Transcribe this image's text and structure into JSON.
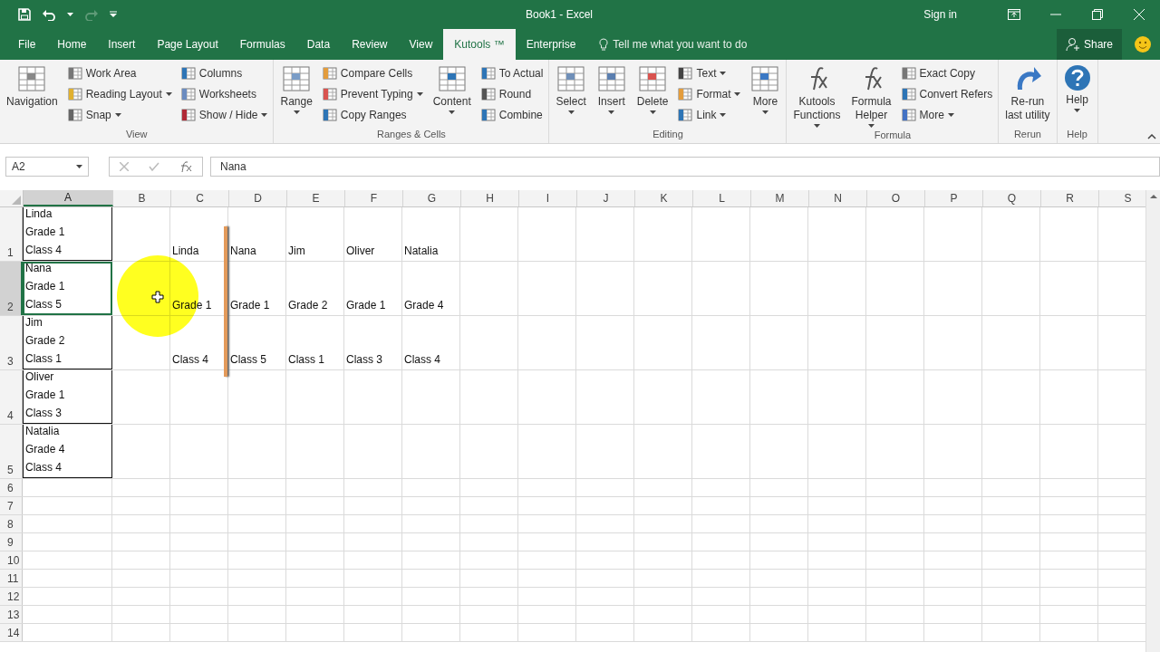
{
  "window": {
    "title": "Book1  -  Excel",
    "sign_in": "Sign in"
  },
  "tabs": [
    {
      "label": "File",
      "selected": false
    },
    {
      "label": "Home",
      "selected": false
    },
    {
      "label": "Insert",
      "selected": false
    },
    {
      "label": "Page Layout",
      "selected": false
    },
    {
      "label": "Formulas",
      "selected": false
    },
    {
      "label": "Data",
      "selected": false
    },
    {
      "label": "Review",
      "selected": false
    },
    {
      "label": "View",
      "selected": false
    },
    {
      "label": "Kutools ™",
      "selected": true
    },
    {
      "label": "Enterprise",
      "selected": false
    }
  ],
  "tell_me": "Tell me what you want to do",
  "share": "Share",
  "ribbon": {
    "groups": [
      {
        "name": "View",
        "items": [
          {
            "kind": "large",
            "label": "Navigation",
            "dropdown": false
          },
          {
            "kind": "stack",
            "items": [
              {
                "label": "Work Area",
                "dropdown": false
              },
              {
                "label": "Reading Layout",
                "dropdown": true
              },
              {
                "label": "Snap",
                "dropdown": true
              }
            ]
          },
          {
            "kind": "stack",
            "items": [
              {
                "label": "Columns",
                "dropdown": false
              },
              {
                "label": "Worksheets",
                "dropdown": false
              },
              {
                "label": "Show / Hide",
                "dropdown": true
              }
            ]
          }
        ]
      },
      {
        "name": "Ranges & Cells",
        "items": [
          {
            "kind": "large",
            "label": "Range",
            "dropdown": true
          },
          {
            "kind": "stack",
            "items": [
              {
                "label": "Compare Cells",
                "dropdown": false
              },
              {
                "label": "Prevent Typing",
                "dropdown": true
              },
              {
                "label": "Copy Ranges",
                "dropdown": false
              }
            ]
          },
          {
            "kind": "large",
            "label": "Content",
            "dropdown": true
          },
          {
            "kind": "stack",
            "items": [
              {
                "label": "To Actual",
                "dropdown": false
              },
              {
                "label": "Round",
                "dropdown": false
              },
              {
                "label": "Combine",
                "dropdown": false
              }
            ]
          }
        ]
      },
      {
        "name": "Editing",
        "items": [
          {
            "kind": "large",
            "label": "Select",
            "dropdown": true
          },
          {
            "kind": "large",
            "label": "Insert",
            "dropdown": true
          },
          {
            "kind": "large",
            "label": "Delete",
            "dropdown": true
          },
          {
            "kind": "stack",
            "items": [
              {
                "label": "Text",
                "dropdown": true
              },
              {
                "label": "Format",
                "dropdown": true
              },
              {
                "label": "Link",
                "dropdown": true
              }
            ]
          },
          {
            "kind": "large",
            "label": "More",
            "dropdown": true
          }
        ]
      },
      {
        "name": "Formula",
        "items": [
          {
            "kind": "large",
            "label": "Kutools\nFunctions",
            "dropdown": true
          },
          {
            "kind": "large",
            "label": "Formula\nHelper",
            "dropdown": true
          },
          {
            "kind": "stack",
            "items": [
              {
                "label": "Exact Copy",
                "dropdown": false
              },
              {
                "label": "Convert Refers",
                "dropdown": false
              },
              {
                "label": "More",
                "dropdown": true
              }
            ]
          }
        ]
      },
      {
        "name": "Rerun",
        "items": [
          {
            "kind": "large",
            "label": "Re-run\nlast utility",
            "dropdown": false
          }
        ]
      },
      {
        "name": "Help",
        "items": [
          {
            "kind": "large",
            "label": "Help",
            "dropdown": true
          }
        ]
      }
    ]
  },
  "formula_bar": {
    "name_box": "A2",
    "value": "Nana"
  },
  "sheet": {
    "columns": [
      {
        "label": "A",
        "selected": true,
        "outlined": true
      },
      {
        "label": "B",
        "selected": false
      },
      {
        "label": "C",
        "selected": false
      },
      {
        "label": "D",
        "selected": false
      },
      {
        "label": "E",
        "selected": false
      },
      {
        "label": "F",
        "selected": false
      },
      {
        "label": "G",
        "selected": false
      },
      {
        "label": "H",
        "selected": false
      },
      {
        "label": "I",
        "selected": false
      },
      {
        "label": "J",
        "selected": false
      },
      {
        "label": "K",
        "selected": false
      },
      {
        "label": "L",
        "selected": false
      },
      {
        "label": "M",
        "selected": false
      },
      {
        "label": "N",
        "selected": false
      },
      {
        "label": "O",
        "selected": false
      },
      {
        "label": "P",
        "selected": false
      },
      {
        "label": "Q",
        "selected": false
      },
      {
        "label": "R",
        "selected": false
      },
      {
        "label": "S",
        "selected": false
      }
    ],
    "rows": [
      {
        "header": "1",
        "selected": false,
        "cells": {
          "A": "Linda\nGrade 1\nClass 4",
          "C": "Linda",
          "D": "Nana",
          "E": "Jim",
          "F": "Oliver",
          "G": "Natalia"
        }
      },
      {
        "header": "2",
        "selected": true,
        "cells": {
          "A": "Nana\nGrade 1\nClass 5",
          "C": "Grade 1",
          "D": "Grade 1",
          "E": "Grade 2",
          "F": "Grade 1",
          "G": "Grade 4"
        }
      },
      {
        "header": "3",
        "selected": false,
        "cells": {
          "A": "Jim\nGrade 2\nClass 1",
          "C": "Class 4",
          "D": "Class 5",
          "E": "Class 1",
          "F": "Class 3",
          "G": "Class 4"
        }
      },
      {
        "header": "4",
        "selected": false,
        "cells": {
          "A": "Oliver\nGrade 1\nClass 3"
        }
      },
      {
        "header": "5",
        "selected": false,
        "cells": {
          "A": "Natalia\nGrade 4\nClass 4"
        }
      },
      {
        "header": "6",
        "selected": false,
        "cells": {}
      },
      {
        "header": "7",
        "selected": false,
        "cells": {}
      },
      {
        "header": "8",
        "selected": false,
        "cells": {}
      },
      {
        "header": "9",
        "selected": false,
        "cells": {}
      },
      {
        "header": "10",
        "selected": false,
        "cells": {}
      },
      {
        "header": "11",
        "selected": false,
        "cells": {}
      },
      {
        "header": "12",
        "selected": false,
        "cells": {}
      },
      {
        "header": "13",
        "selected": false,
        "cells": {}
      },
      {
        "header": "14",
        "selected": false,
        "cells": {}
      }
    ]
  }
}
